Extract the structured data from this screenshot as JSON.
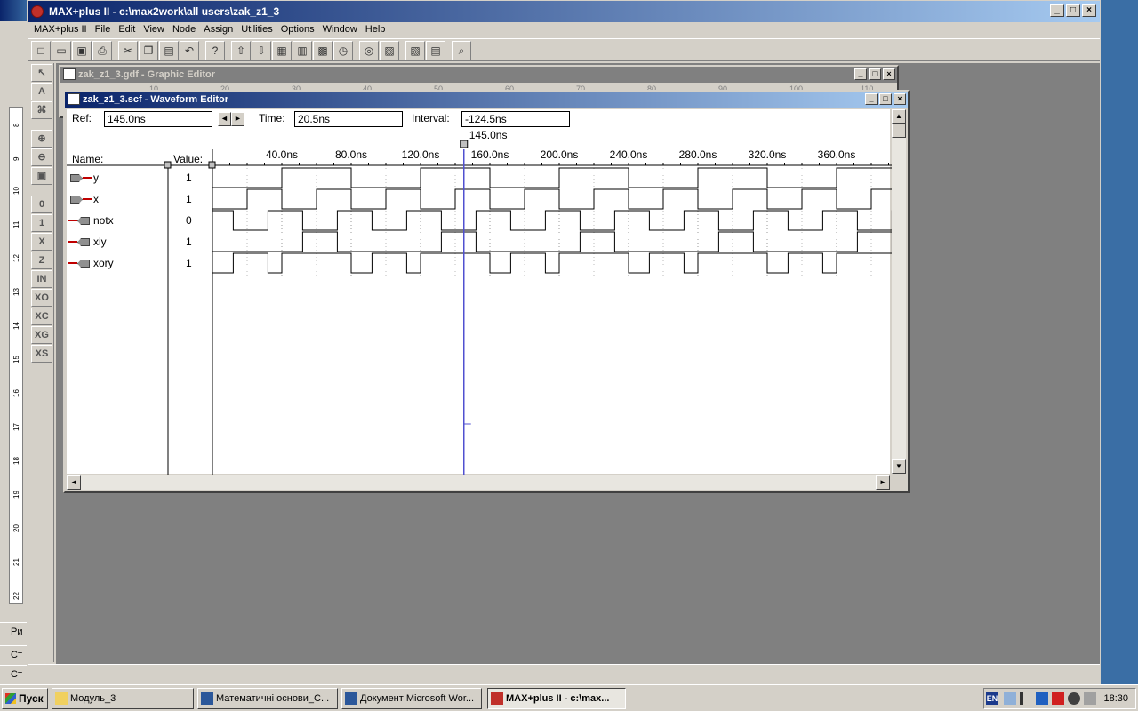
{
  "app": {
    "title": "MAX+plus II - c:\\max2work\\all users\\zak_z1_3",
    "menu": [
      "MAX+plus II",
      "File",
      "Edit",
      "View",
      "Node",
      "Assign",
      "Utilities",
      "Options",
      "Window",
      "Help"
    ]
  },
  "toolbar_icons": [
    "new-icon",
    "open-icon",
    "save-icon",
    "print-icon",
    "cut-icon",
    "copy-icon",
    "paste-icon",
    "undo-icon",
    "help-icon",
    "hierarchy-up-icon",
    "hierarchy-down-icon",
    "floorplan-icon",
    "compile-icon",
    "simulate-icon",
    "timing-icon",
    "programmer-icon",
    "open-sch-icon",
    "open-wave-icon",
    "open-rpt-icon",
    "find-icon"
  ],
  "palette_icons": [
    "select-arrow-icon",
    "text-tool-icon",
    "node-tool-icon",
    "zoom-in-icon",
    "zoom-out-icon",
    "fit-icon",
    "zero-icon",
    "one-icon",
    "x-icon",
    "z-icon",
    "inv-icon",
    "xo-icon",
    "xc-icon",
    "xg-icon",
    "xs-icon"
  ],
  "graphic_editor": {
    "title": "zak_z1_3.gdf - Graphic Editor",
    "ruler": [
      "10",
      "20",
      "30",
      "40",
      "50",
      "60",
      "70",
      "80",
      "90",
      "100",
      "110"
    ]
  },
  "waveform_editor": {
    "title": "zak_z1_3.scf - Waveform Editor",
    "ref_label": "Ref:",
    "ref_value": "145.0ns",
    "time_label": "Time:",
    "time_value": "20.5ns",
    "interval_label": "Interval:",
    "interval_value": "-124.5ns",
    "cursor_label": "145.0ns",
    "name_header": "Name:",
    "value_header": "Value:",
    "time_ticks": [
      "40.0ns",
      "80.0ns",
      "120.0ns",
      "160.0ns",
      "200.0ns",
      "240.0ns",
      "280.0ns",
      "320.0ns",
      "360.0ns",
      "4"
    ],
    "signals": [
      {
        "name": "y",
        "value": "1",
        "kind": "input"
      },
      {
        "name": "x",
        "value": "1",
        "kind": "input"
      },
      {
        "name": "notx",
        "value": "0",
        "kind": "output"
      },
      {
        "name": "xiy",
        "value": "1",
        "kind": "output"
      },
      {
        "name": "xory",
        "value": "1",
        "kind": "output"
      }
    ]
  },
  "word_bg": {
    "ruler_numbers": [
      "8",
      "9",
      "10",
      "11",
      "12",
      "13",
      "14",
      "15",
      "16",
      "17",
      "18",
      "19",
      "20",
      "21",
      "22"
    ],
    "status_1": "Ри",
    "status_2": "Ст",
    "status_3": "Ст"
  },
  "taskbar": {
    "start_label": "Пуск",
    "tasks": [
      "Модуль_3",
      "Математичні основи_С...",
      "Документ Microsoft Wor...",
      "MAX+plus II - c:\\max..."
    ],
    "lang": "EN",
    "clock": "18:30"
  }
}
